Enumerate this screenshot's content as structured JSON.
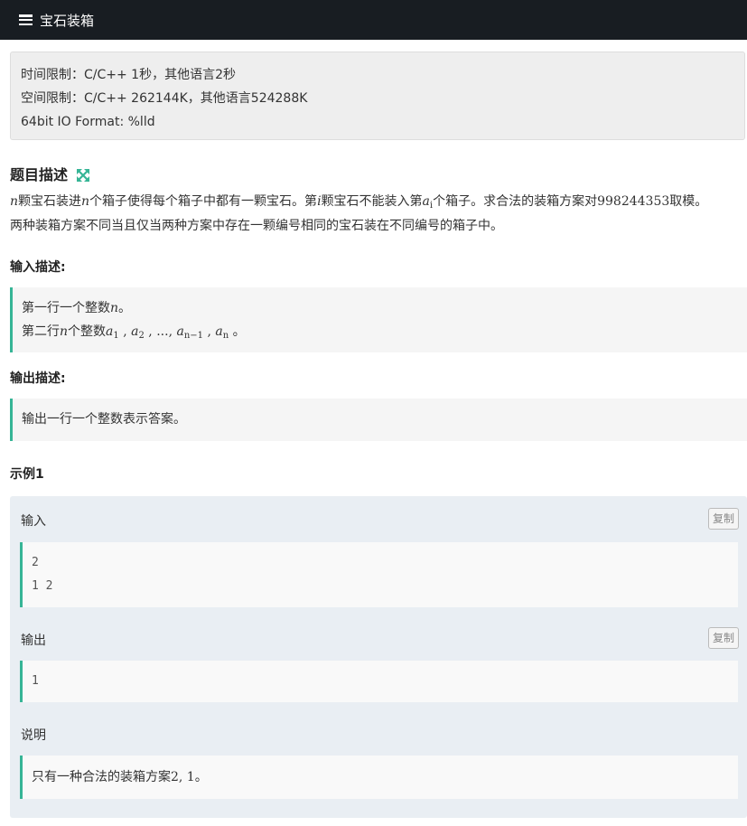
{
  "header": {
    "title": "宝石装箱",
    "icon": "list-icon"
  },
  "limits": {
    "time": "时间限制：C/C++ 1秒，其他语言2秒",
    "space": "空间限制：C/C++ 262144K，其他语言524288K",
    "format": "64bit IO Format: %lld"
  },
  "description": {
    "title": "题目描述",
    "line1_a": "颗宝石装进",
    "line1_b": "个箱子使得每个箱子中都有一颗宝石。第",
    "line1_c": "颗宝石不能装入第",
    "line1_d": "个箱子。求合法的装箱方案对",
    "line1_e": "取模。",
    "modulus": "998244353",
    "line2": "两种装箱方案不同当且仅当两种方案中存在一颗编号相同的宝石装在不同编号的箱子中。",
    "var_n": "n",
    "var_i": "i",
    "var_a": "a",
    "sub_i": "i"
  },
  "input_desc": {
    "title": "输入描述:",
    "line1_a": "第一行一个整数",
    "line1_end": "。",
    "line2_a": "第二行",
    "line2_b": "个整数",
    "seq": [
      "1",
      "2",
      "n−1",
      "n"
    ],
    "ellipsis": "...",
    "line2_end": "。"
  },
  "output_desc": {
    "title": "输出描述:",
    "text": "输出一行一个整数表示答案。"
  },
  "example": {
    "title": "示例1",
    "input_label": "输入",
    "copy_label": "复制",
    "input_lines": [
      "2",
      "1 2"
    ],
    "output_label": "输出",
    "output_lines": [
      "1"
    ],
    "note_label": "说明",
    "note_text": "只有一种合法的装箱方案",
    "note_math": "2, 1",
    "note_end": "。"
  },
  "colors": {
    "header_bg": "#181d22",
    "accent": "#36b596",
    "example_bg": "#e9eef3"
  }
}
